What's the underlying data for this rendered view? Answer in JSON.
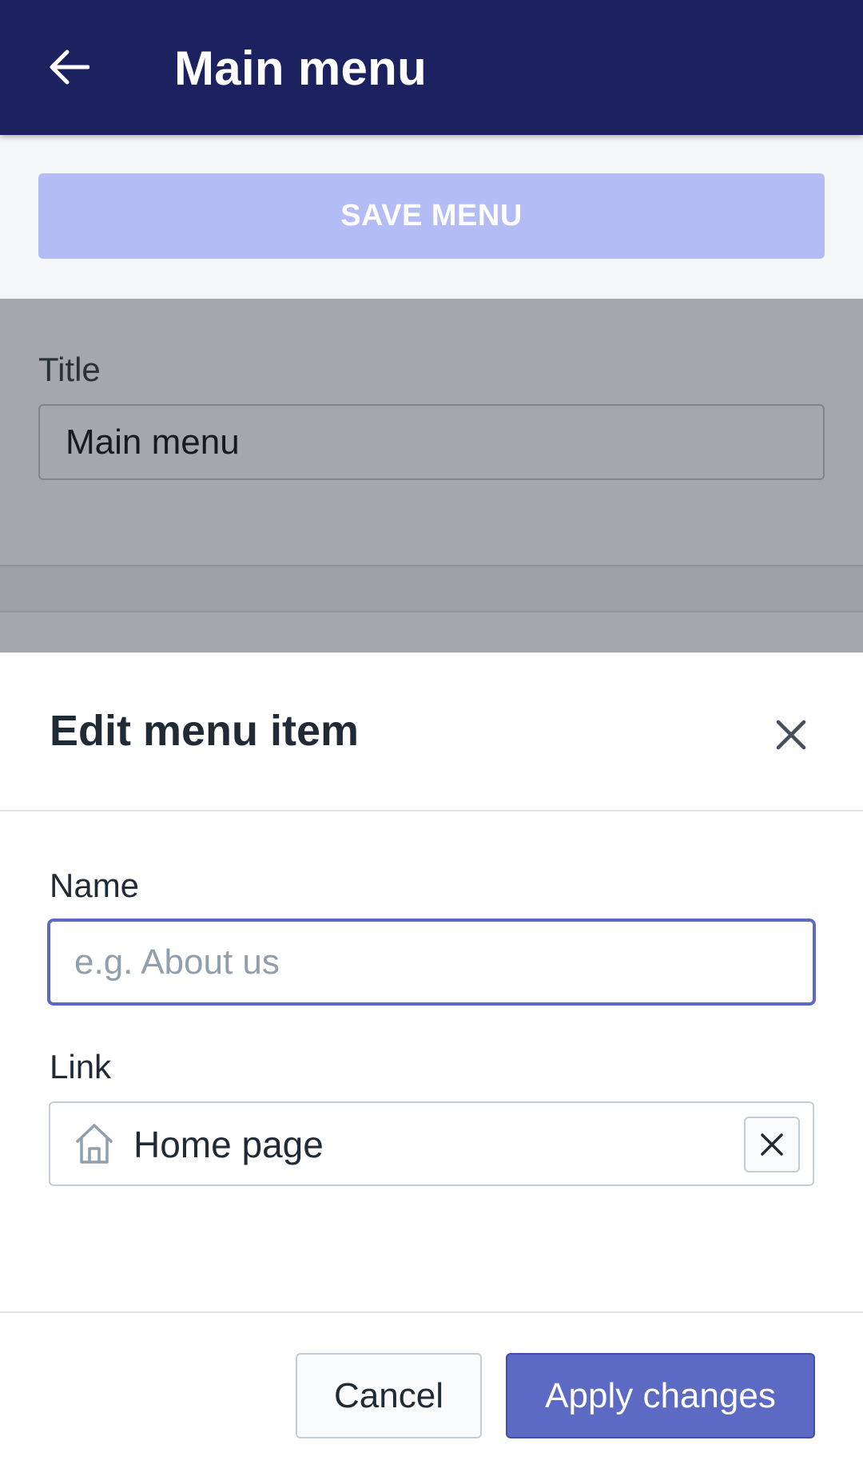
{
  "app_bar": {
    "title": "Main menu",
    "back_icon": "arrow-left-icon",
    "background_color": "#1c2260"
  },
  "save_bar": {
    "save_label": "SAVE MENU",
    "save_color": "#b3bcf5"
  },
  "menu_form": {
    "title_label": "Title",
    "title_value": "Main menu"
  },
  "edit_dialog": {
    "title": "Edit menu item",
    "close_icon": "close-icon",
    "name_label": "Name",
    "name_value": "",
    "name_placeholder": "e.g. About us",
    "link_label": "Link",
    "link_icon": "home-icon",
    "link_value": "Home page",
    "link_clear_icon": "close-icon",
    "cancel_label": "Cancel",
    "apply_label": "Apply changes",
    "accent_color": "#5c6ac4"
  }
}
